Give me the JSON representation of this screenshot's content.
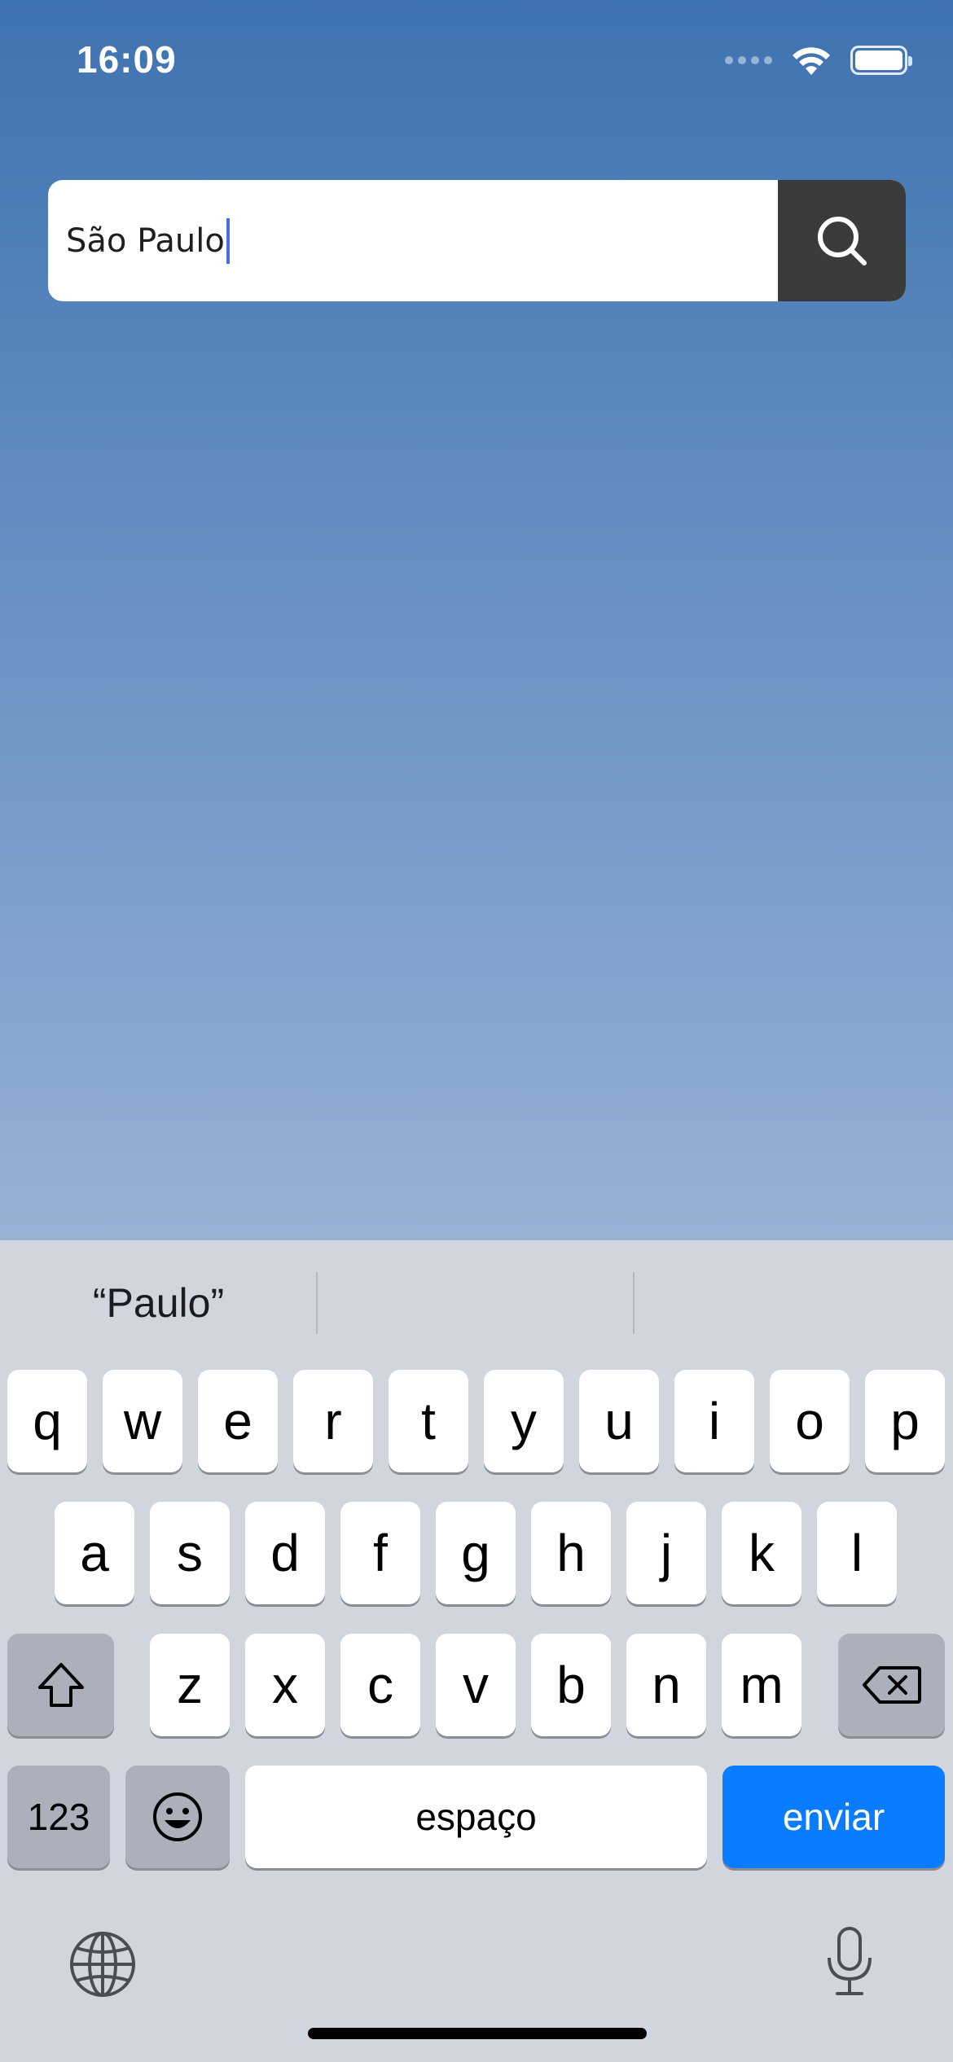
{
  "status_bar": {
    "time": "16:09"
  },
  "search": {
    "value": "São Paulo",
    "button_icon": "search-icon"
  },
  "keyboard": {
    "suggestions": [
      "“Paulo”",
      "",
      ""
    ],
    "row1": [
      "q",
      "w",
      "e",
      "r",
      "t",
      "y",
      "u",
      "i",
      "o",
      "p"
    ],
    "row2": [
      "a",
      "s",
      "d",
      "f",
      "g",
      "h",
      "j",
      "k",
      "l"
    ],
    "row3": [
      "z",
      "x",
      "c",
      "v",
      "b",
      "n",
      "m"
    ],
    "numbers_label": "123",
    "space_label": "espaço",
    "return_label": "enviar",
    "shift_icon": "shift-icon",
    "delete_icon": "delete-icon",
    "emoji_icon": "emoji-icon",
    "globe_icon": "globe-icon",
    "mic_icon": "microphone-icon",
    "accent_color": "#0a7cff"
  }
}
